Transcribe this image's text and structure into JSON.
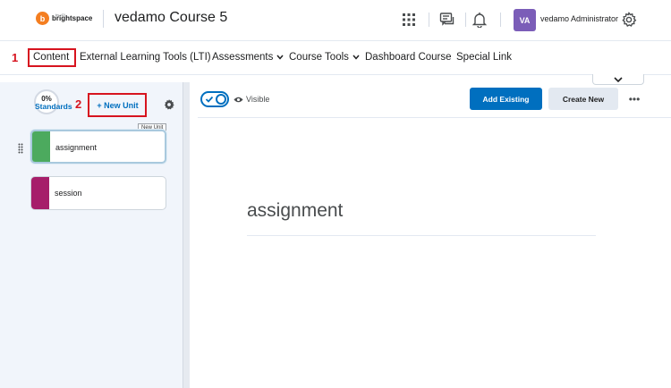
{
  "header": {
    "logo_text": "brightspace",
    "logo_sub": "by d2l",
    "course_title": "vedamo Course 5",
    "user_initials": "VA",
    "user_name": "vedamo Administrator",
    "icons": [
      "waffle-icon",
      "message-icon",
      "bell-icon",
      "gear-icon"
    ]
  },
  "nav": {
    "items": [
      {
        "label": "Content",
        "dropdown": false
      },
      {
        "label": "External Learning Tools (LTI)",
        "dropdown": false
      },
      {
        "label": "Assessments",
        "dropdown": true
      },
      {
        "label": "Course Tools",
        "dropdown": true
      },
      {
        "label": "Dashboard Course",
        "dropdown": false
      },
      {
        "label": "Special Link",
        "dropdown": false
      }
    ]
  },
  "annotations": {
    "step1": "1",
    "step2": "2",
    "highlight_color": "#d7141f"
  },
  "left_panel": {
    "progress": "0%",
    "standards_label": "Standards",
    "new_unit_label": "+ New Unit",
    "tooltip": "New Unit",
    "units": [
      {
        "label": "assignment",
        "color": "#4caa5e",
        "active": true
      },
      {
        "label": "session",
        "color": "#a61e6a",
        "active": false
      }
    ]
  },
  "main": {
    "visible_label": "Visible",
    "add_existing_label": "Add Existing",
    "create_new_label": "Create New",
    "more_label": "•••",
    "unit_title": "assignment",
    "accent_color": "#006fbf"
  }
}
